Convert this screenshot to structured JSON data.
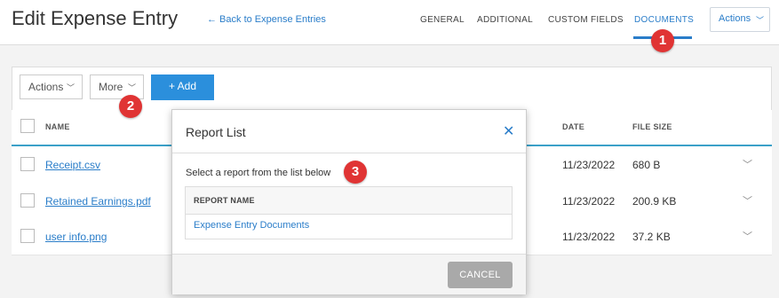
{
  "header": {
    "title": "Edit Expense Entry",
    "back_link": "← Back to Expense Entries",
    "tabs": [
      {
        "label": "GENERAL"
      },
      {
        "label": "ADDITIONAL"
      },
      {
        "label": "CUSTOM FIELDS"
      },
      {
        "label": "DOCUMENTS",
        "active": true
      }
    ],
    "actions_label": "Actions"
  },
  "toolbar": {
    "actions_label": "Actions",
    "more_label": "More",
    "add_label": "+ Add"
  },
  "table": {
    "columns": [
      "NAME",
      "DATE",
      "FILE SIZE"
    ],
    "rows": [
      {
        "name": "Receipt.csv",
        "date": "11/23/2022",
        "size": "680 B"
      },
      {
        "name": "Retained Earnings.pdf",
        "date": "11/23/2022",
        "size": "200.9 KB"
      },
      {
        "name": "user info.png",
        "date": "11/23/2022",
        "size": "37.2 KB"
      }
    ]
  },
  "modal": {
    "title": "Report List",
    "instruction": "Select a report from the list below",
    "column_header": "REPORT NAME",
    "reports": [
      "Expense Entry Documents"
    ],
    "cancel_label": "CANCEL"
  },
  "badges": [
    "1",
    "2",
    "3"
  ],
  "colors": {
    "accent": "#2a7dc9",
    "badge": "#e03434",
    "add_button": "#2b8fdc"
  },
  "icons": [
    "chevron-down-icon",
    "close-icon",
    "plus-icon"
  ]
}
